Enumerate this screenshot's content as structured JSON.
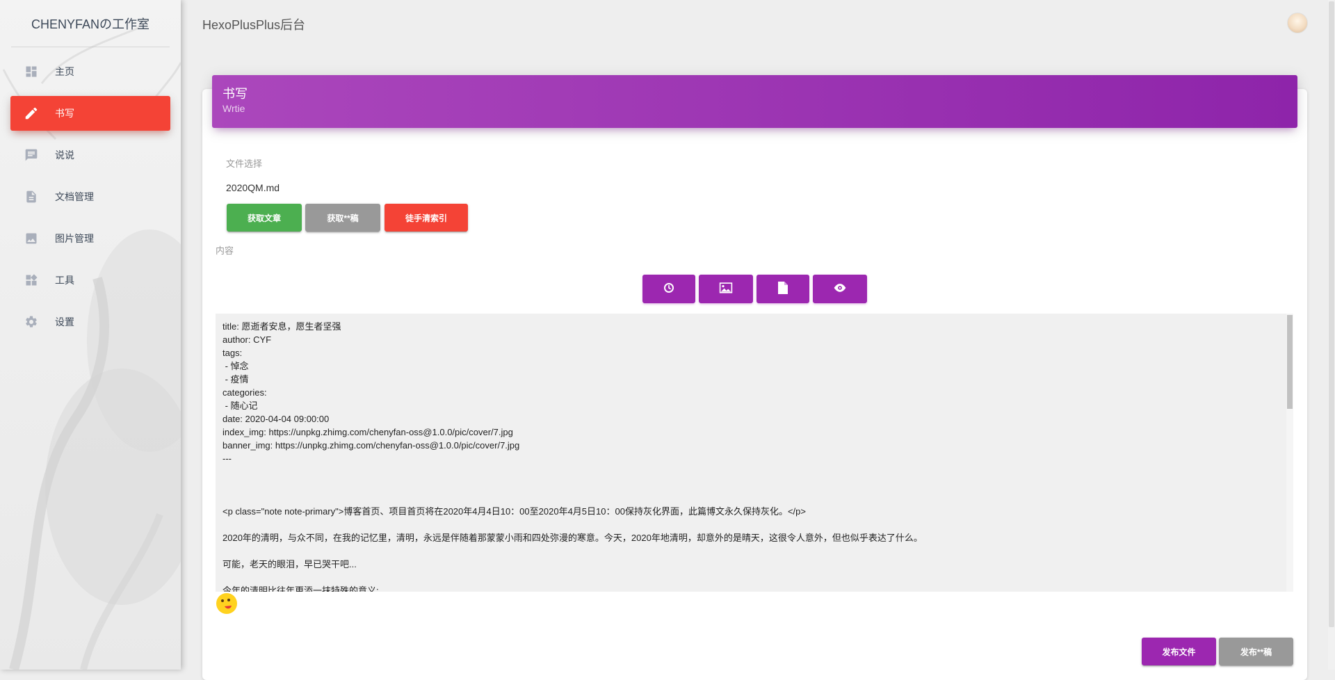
{
  "sidebar": {
    "brand": "CHENYFANの工作室",
    "items": [
      {
        "label": "主页",
        "icon": "dashboard-icon",
        "active": false
      },
      {
        "label": "书写",
        "icon": "pencil-icon",
        "active": true
      },
      {
        "label": "说说",
        "icon": "chat-icon",
        "active": false
      },
      {
        "label": "文档管理",
        "icon": "document-icon",
        "active": false
      },
      {
        "label": "图片管理",
        "icon": "image-icon",
        "active": false
      },
      {
        "label": "工具",
        "icon": "widgets-icon",
        "active": false
      },
      {
        "label": "设置",
        "icon": "gear-icon",
        "active": false
      }
    ],
    "active_color": "#f44336"
  },
  "topbar": {
    "title": "HexoPlusPlus后台",
    "avatar_icon": "avatar"
  },
  "card": {
    "title": "书写",
    "subtitle": "Wrtie",
    "header_color": "#9c27b0",
    "file_label": "文件选择",
    "file_value": "2020QM.md",
    "buttons": {
      "get_article": "获取文章",
      "get_draft": "获取**稿",
      "clean_index": "徒手清索引"
    },
    "content_label": "内容",
    "toolbar_icons": [
      "clock-icon",
      "image-icon",
      "file-icon",
      "eye-icon"
    ],
    "editor_text": "title: 愿逝者安息，愿生者坚强\nauthor: CYF\ntags:\n - 悼念\n - 疫情\ncategories:\n - 随心记\ndate: 2020-04-04 09:00:00\nindex_img: https://unpkg.zhimg.com/chenyfan-oss@1.0.0/pic/cover/7.jpg\nbanner_img: https://unpkg.zhimg.com/chenyfan-oss@1.0.0/pic/cover/7.jpg\n---\n\n\n\n<p class=\"note note-primary\">博客首页、项目首页将在2020年4月4日10：00至2020年4月5日10：00保持灰化界面，此篇博文永久保持灰化。</p>\n\n2020年的清明，与众不同，在我的记忆里，清明，永远是伴随着那蒙蒙小雨和四处弥漫的寒意。今天，2020年地清明，却意外的是晴天，这很令人意外，但也似乎表达了什么。\n\n可能，老天的眼泪，早已哭干吧...\n\n今年的清明比往年更添一抹特殊的意义;",
    "publish_file": "发布文件",
    "publish_draft": "发布**稿"
  }
}
